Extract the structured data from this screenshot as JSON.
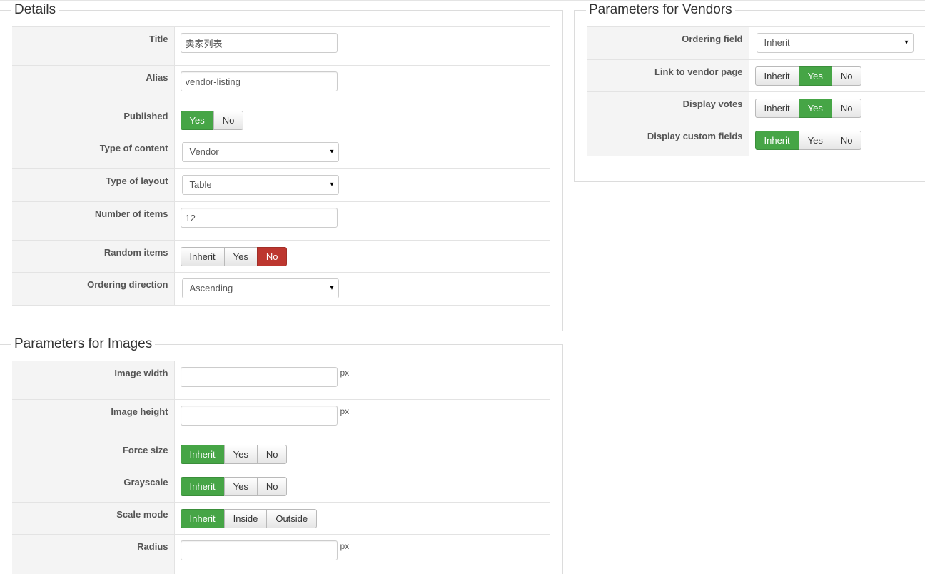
{
  "details": {
    "legend": "Details",
    "title_label": "Title",
    "title_value": "卖家列表",
    "alias_label": "Alias",
    "alias_value": "vendor-listing",
    "published_label": "Published",
    "published_options": [
      "Yes",
      "No"
    ],
    "type_content_label": "Type of content",
    "type_content_value": "Vendor",
    "type_layout_label": "Type of layout",
    "type_layout_value": "Table",
    "number_items_label": "Number of items",
    "number_items_value": "12",
    "random_items_label": "Random items",
    "random_items_options": [
      "Inherit",
      "Yes",
      "No"
    ],
    "ordering_direction_label": "Ordering direction",
    "ordering_direction_value": "Ascending"
  },
  "images": {
    "legend": "Parameters for Images",
    "width_label": "Image width",
    "width_value": "",
    "height_label": "Image height",
    "height_value": "",
    "unit": "px",
    "force_size_label": "Force size",
    "force_size_options": [
      "Inherit",
      "Yes",
      "No"
    ],
    "grayscale_label": "Grayscale",
    "grayscale_options": [
      "Inherit",
      "Yes",
      "No"
    ],
    "scale_mode_label": "Scale mode",
    "scale_mode_options": [
      "Inherit",
      "Inside",
      "Outside"
    ],
    "radius_label": "Radius",
    "radius_value": ""
  },
  "vendors": {
    "legend": "Parameters for Vendors",
    "ordering_field_label": "Ordering field",
    "ordering_field_value": "Inherit",
    "link_label": "Link to vendor page",
    "link_options": [
      "Inherit",
      "Yes",
      "No"
    ],
    "votes_label": "Display votes",
    "votes_options": [
      "Inherit",
      "Yes",
      "No"
    ],
    "custom_fields_label": "Display custom fields",
    "custom_fields_options": [
      "Inherit",
      "Yes",
      "No"
    ]
  },
  "colors": {
    "active_green": "#46a546",
    "active_red": "#bd362f"
  },
  "icons": {
    "select_caret": "▾"
  }
}
